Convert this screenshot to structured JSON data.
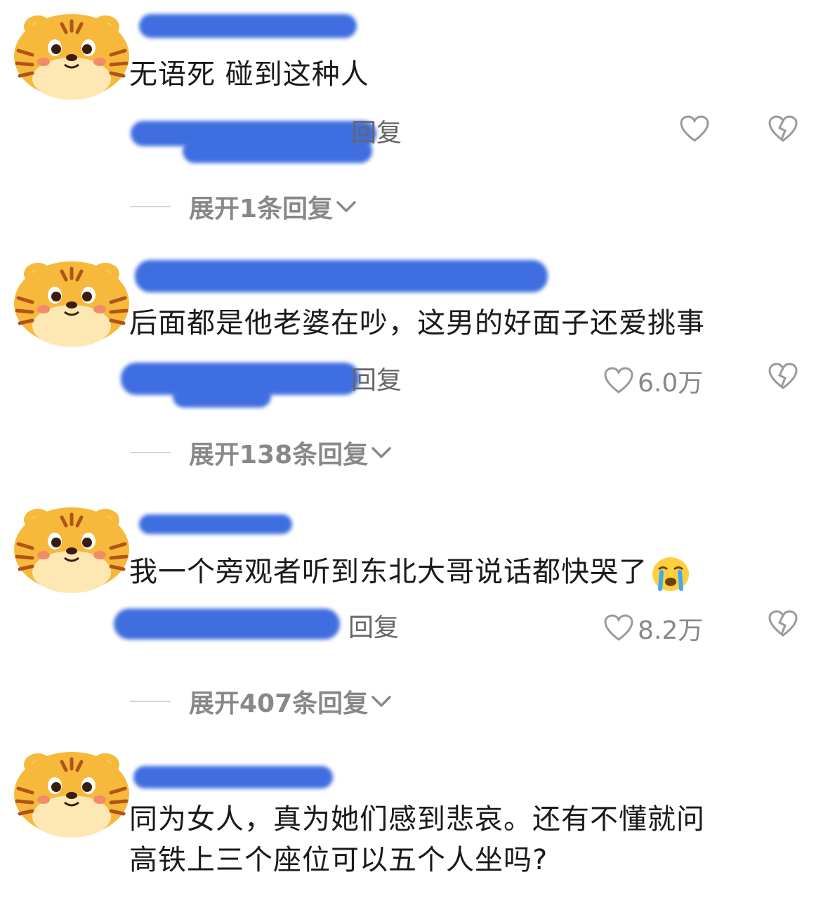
{
  "comments": [
    {
      "text": "无语死 碰到这种人",
      "reply_label": "回复",
      "like_count": "",
      "expand_label": "展开1条回复"
    },
    {
      "text": "后面都是他老婆在吵，这男的好面子还爱挑事",
      "reply_label": "回复",
      "like_count": "6.0万",
      "expand_label": "展开138条回复"
    },
    {
      "text": "我一个旁观者听到东北大哥说话都快哭了",
      "emoji": "crying-face",
      "reply_label": "回复",
      "like_count": "8.2万",
      "expand_label": "展开407条回复"
    },
    {
      "text_line1": "同为女人，真为她们感到悲哀。还有不懂就问",
      "text_line2": "高铁上三个座位可以五个人坐吗?"
    }
  ],
  "colors": {
    "redaction": "#3f6ee0",
    "tiger": "#f6b93b",
    "tiger_face": "#fde8b4"
  },
  "icons": [
    "tiger-avatar-icon",
    "heart-icon",
    "broken-heart-icon",
    "chevron-down-icon",
    "crying-face-emoji"
  ]
}
